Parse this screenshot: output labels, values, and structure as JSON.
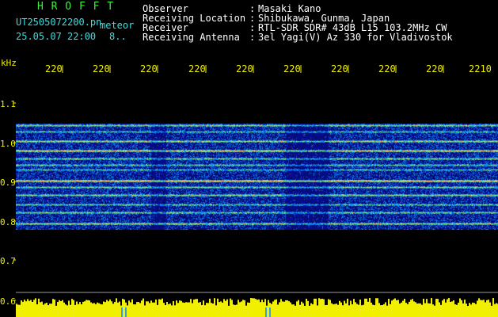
{
  "header": {
    "title": "H R O F F T",
    "filename": "UT2505072200.pn",
    "suffix": "meteor",
    "datetime": "25.05.07 22:00",
    "count": "8..",
    "info_labels": [
      "Observer",
      "Receiving Location",
      "Receiver",
      "Receiving Antenna"
    ],
    "info_colons": [
      ":",
      ":",
      ":",
      ":"
    ],
    "info_values": [
      "Masaki Kano",
      "Shibukawa, Gunma, Japan",
      "RTL-SDR SDR# 43dB L15 103.2MHz CW",
      "3el Yagi(V) Az 330 for Vladivostok"
    ]
  },
  "x_axis": {
    "ticks": [
      "220",
      "220",
      "220",
      "220",
      "220",
      "220",
      "220",
      "220",
      "220",
      "2210"
    ]
  },
  "y_axis": {
    "unit": "kHz",
    "ticks": [
      "1.1",
      "1.0",
      "0.9",
      "0.8",
      "0.7",
      "0.6"
    ]
  },
  "colors": {
    "title": "#3cf03c",
    "filename": "#35e0e0",
    "ticks": "#f0f000",
    "power": "#f0f000",
    "spectrogram_background": "#06083a"
  }
}
